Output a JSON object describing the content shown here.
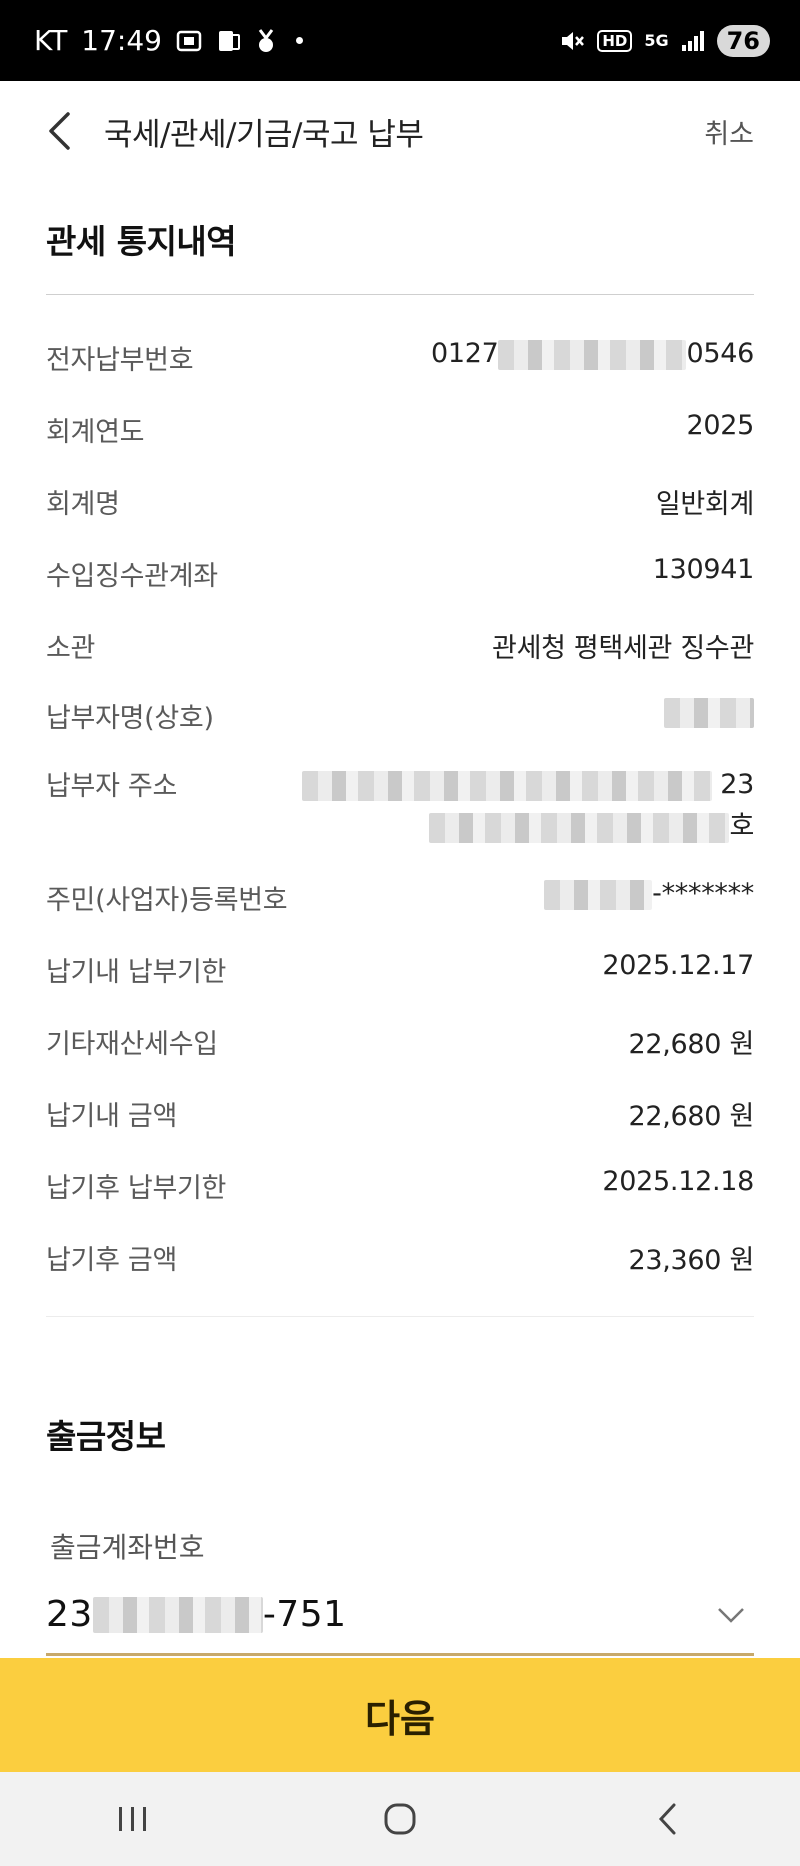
{
  "status_bar": {
    "carrier": "KT",
    "time": "17:49",
    "network": "5G",
    "hd_label": "HD",
    "battery": "76"
  },
  "header": {
    "title": "국세/관세/기금/국고 납부",
    "cancel_label": "취소"
  },
  "notice": {
    "title": "관세 통지내역",
    "rows": [
      {
        "label": "전자납부번호",
        "value_prefix": "0127",
        "value_suffix": "0546"
      },
      {
        "label": "회계연도",
        "value": "2025"
      },
      {
        "label": "회계명",
        "value": "일반회계"
      },
      {
        "label": "수입징수관계좌",
        "value": "130941"
      },
      {
        "label": "소관",
        "value": "관세청 평택세관 징수관"
      },
      {
        "label": "납부자명(상호)",
        "value": ""
      },
      {
        "label": "납부자 주소",
        "value_line1_suffix": "23",
        "value_line2_suffix": "호"
      },
      {
        "label": "주민(사업자)등록번호",
        "value_suffix": "-*******"
      },
      {
        "label": "납기내 납부기한",
        "value": "2025.12.17"
      },
      {
        "label": "기타재산세수입",
        "value": "22,680 원"
      },
      {
        "label": "납기내 금액",
        "value": "22,680 원"
      },
      {
        "label": "납기후 납부기한",
        "value": "2025.12.18"
      },
      {
        "label": "납기후 금액",
        "value": "23,360 원"
      }
    ]
  },
  "withdrawal": {
    "title": "출금정보",
    "account_label": "출금계좌번호",
    "account_prefix": "23",
    "account_suffix": "-751"
  },
  "next_button_label": "다음",
  "colors": {
    "accent": "#fbce3f",
    "underline": "#c8a96a"
  }
}
